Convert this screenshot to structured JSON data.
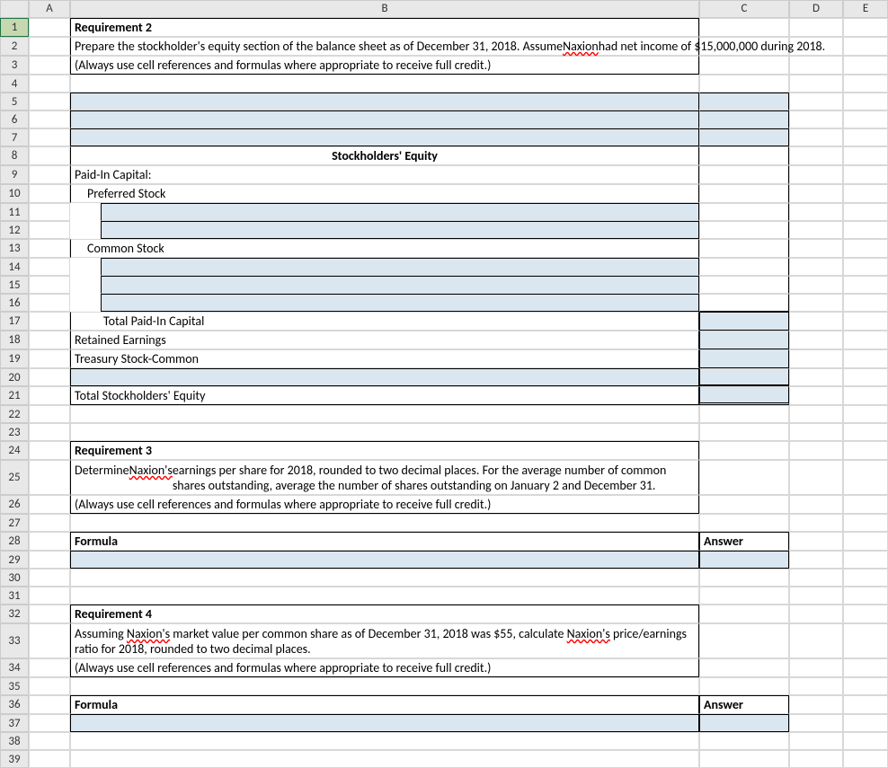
{
  "columns": [
    "A",
    "B",
    "C",
    "D",
    "E"
  ],
  "row_numbers": [
    1,
    2,
    3,
    4,
    5,
    6,
    7,
    8,
    9,
    10,
    11,
    12,
    13,
    14,
    15,
    16,
    17,
    18,
    19,
    20,
    21,
    22,
    23,
    24,
    25,
    26,
    27,
    28,
    29,
    30,
    31,
    32,
    33,
    34,
    35,
    36,
    37,
    38,
    39
  ],
  "selected_row": 1,
  "r1": {
    "b": "Requirement 2"
  },
  "r2": {
    "b_pre": "Prepare the stockholder's equity section of the balance sheet as of December 31, 2018.  Assume ",
    "b_nax": "Naxion",
    "b_post": " had net income of $15,000,000 during 2018."
  },
  "r3": {
    "b": "(Always use cell references and formulas where appropriate to receive full credit.)"
  },
  "r8": {
    "b": "Stockholders' Equity"
  },
  "r9": {
    "b": "Paid-In Capital:"
  },
  "r10": {
    "b": "Preferred Stock"
  },
  "r13": {
    "b": "Common Stock"
  },
  "r17": {
    "b": "Total Paid-In Capital"
  },
  "r18": {
    "b": "Retained Earnings"
  },
  "r19": {
    "b": "Treasury Stock-Common"
  },
  "r21": {
    "b": "Total Stockholders' Equity"
  },
  "r24": {
    "b": "Requirement 3"
  },
  "r25": {
    "b_pre": "Determine ",
    "b_nax": "Naxion's",
    "b_post": " earnings per share for 2018, rounded to two decimal places. For the average number of common shares outstanding, average the number of shares outstanding on January 2 and December 31."
  },
  "r26": {
    "b": "(Always use cell references and formulas where appropriate to receive full credit.)"
  },
  "r28": {
    "b": "Formula",
    "c": "Answer"
  },
  "r32": {
    "b": "Requirement 4"
  },
  "r33": {
    "b_pre": "Assuming ",
    "b_nax1": "Naxion's",
    "b_mid": " market value per common share as of December 31, 2018 was $55, calculate ",
    "b_nax2": "Naxion's",
    "b_post": " price/earnings ratio for 2018, rounded to two decimal places."
  },
  "r34": {
    "b": "(Always use cell references and formulas where appropriate to receive full credit.)"
  },
  "r36": {
    "b": "Formula",
    "c": "Answer"
  }
}
